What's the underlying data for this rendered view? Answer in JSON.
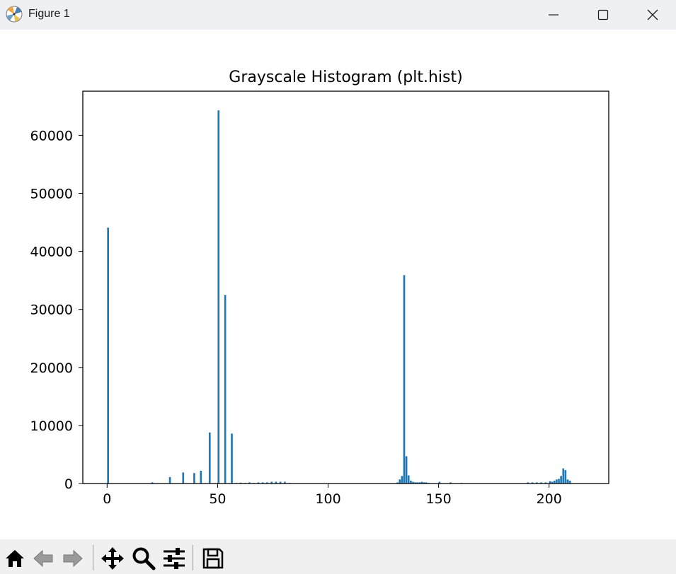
{
  "window": {
    "title": "Figure 1",
    "icons": {
      "app": "matplotlib-icon",
      "minimize": "minimize-icon",
      "maximize": "maximize-icon",
      "close": "close-icon"
    }
  },
  "toolbar": {
    "buttons": [
      "home-icon",
      "back-arrow-icon",
      "forward-arrow-icon",
      "pan-move-icon",
      "zoom-magnifier-icon",
      "configure-subplots-icon",
      "save-disk-icon"
    ]
  },
  "chart_data": {
    "type": "bar",
    "title": "Grayscale Histogram (plt.hist)",
    "xlabel": "",
    "ylabel": "",
    "xlim": [
      -11,
      227
    ],
    "ylim": [
      0,
      67600
    ],
    "xticks": [
      0,
      50,
      100,
      150,
      200
    ],
    "yticks": [
      0,
      10000,
      20000,
      30000,
      40000,
      50000,
      60000
    ],
    "grid": false,
    "bar_color": "#1f77b4",
    "bin_width": 0.85,
    "series": [
      {
        "x": [
          0,
          20,
          28,
          34,
          39,
          42,
          46,
          50,
          53,
          56,
          58,
          60,
          62,
          64,
          66,
          68,
          70,
          72,
          74,
          76,
          78,
          80,
          82,
          131,
          132,
          133,
          134,
          135,
          136,
          137,
          138,
          139,
          140,
          141,
          142,
          143,
          144,
          145,
          150,
          155,
          160,
          190,
          192,
          194,
          196,
          198,
          200,
          201,
          202,
          203,
          204,
          205,
          206,
          207,
          208,
          209
        ],
        "values": [
          44100,
          200,
          1100,
          1900,
          1800,
          2200,
          8800,
          64300,
          32500,
          8600,
          100,
          150,
          100,
          200,
          100,
          200,
          200,
          200,
          300,
          300,
          300,
          300,
          100,
          200,
          700,
          1300,
          35900,
          4700,
          1400,
          500,
          300,
          200,
          200,
          200,
          300,
          200,
          200,
          100,
          300,
          200,
          100,
          200,
          200,
          200,
          200,
          200,
          400,
          300,
          500,
          700,
          800,
          1300,
          2600,
          2300,
          700,
          500
        ]
      }
    ]
  }
}
